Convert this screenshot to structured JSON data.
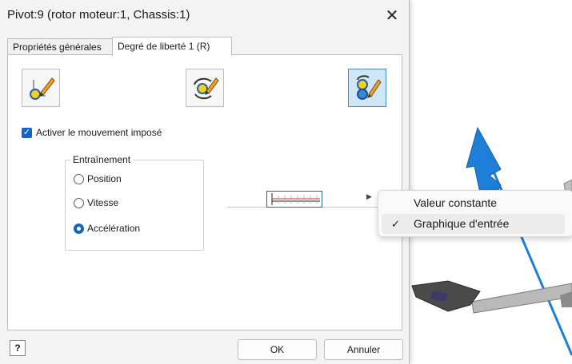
{
  "dialog": {
    "title": "Pivot:9 (rotor moteur:1, Chassis:1)",
    "close_glyph": "✕",
    "tabs": [
      {
        "label": "Propriétés générales",
        "active": false
      },
      {
        "label": "Degré de liberté 1 (R)",
        "active": true
      }
    ],
    "tool_icons": [
      {
        "name": "edit-position-icon",
        "selected": false
      },
      {
        "name": "edit-rotation-icon",
        "selected": false
      },
      {
        "name": "imposed-motion-icon",
        "selected": true
      }
    ],
    "enable_motion": {
      "label": "Activer le mouvement imposé",
      "checked": true
    },
    "drive_group": {
      "legend": "Entraînement",
      "options": [
        {
          "label": "Position",
          "selected": false
        },
        {
          "label": "Vitesse",
          "selected": false
        },
        {
          "label": "Accélération",
          "selected": true
        }
      ]
    },
    "input_graph": {
      "arrow_glyph": "▶"
    },
    "help_glyph": "?",
    "ok_label": "OK",
    "cancel_label": "Annuler"
  },
  "context_menu": {
    "items": [
      {
        "label": "Valeur constante",
        "checked": false
      },
      {
        "label": "Graphique d'entrée",
        "checked": true
      }
    ],
    "check_glyph": "✓"
  },
  "colors": {
    "accent": "#1565c0",
    "arrow_blue": "#1e7fd8"
  }
}
